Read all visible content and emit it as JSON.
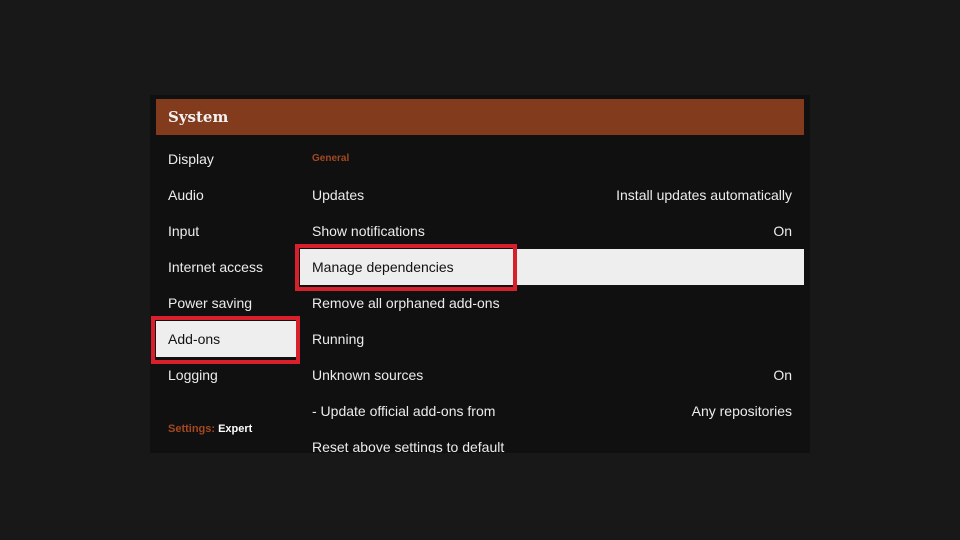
{
  "header": {
    "title": "System"
  },
  "sidebar": {
    "items": [
      {
        "label": "Display"
      },
      {
        "label": "Audio"
      },
      {
        "label": "Input"
      },
      {
        "label": "Internet access"
      },
      {
        "label": "Power saving"
      },
      {
        "label": "Add-ons",
        "selected": true
      },
      {
        "label": "Logging"
      }
    ],
    "settings_level": {
      "label": "Settings:",
      "value": "Expert"
    }
  },
  "content": {
    "section": "General",
    "rows": [
      {
        "label": "Updates",
        "value": "Install updates automatically"
      },
      {
        "label": "Show notifications",
        "value": "On"
      },
      {
        "label": "Manage dependencies",
        "value": "",
        "focused": true
      },
      {
        "label": "Remove all orphaned add-ons",
        "value": ""
      },
      {
        "label": "Running",
        "value": ""
      },
      {
        "label": "Unknown sources",
        "value": "On"
      },
      {
        "label": "- Update official add-ons from",
        "value": "Any repositories"
      },
      {
        "label": "Reset above settings to default",
        "value": ""
      }
    ]
  },
  "colors": {
    "accent": "#823b1c",
    "highlight": "#d8202c",
    "selected_bg": "#eeeeee"
  }
}
